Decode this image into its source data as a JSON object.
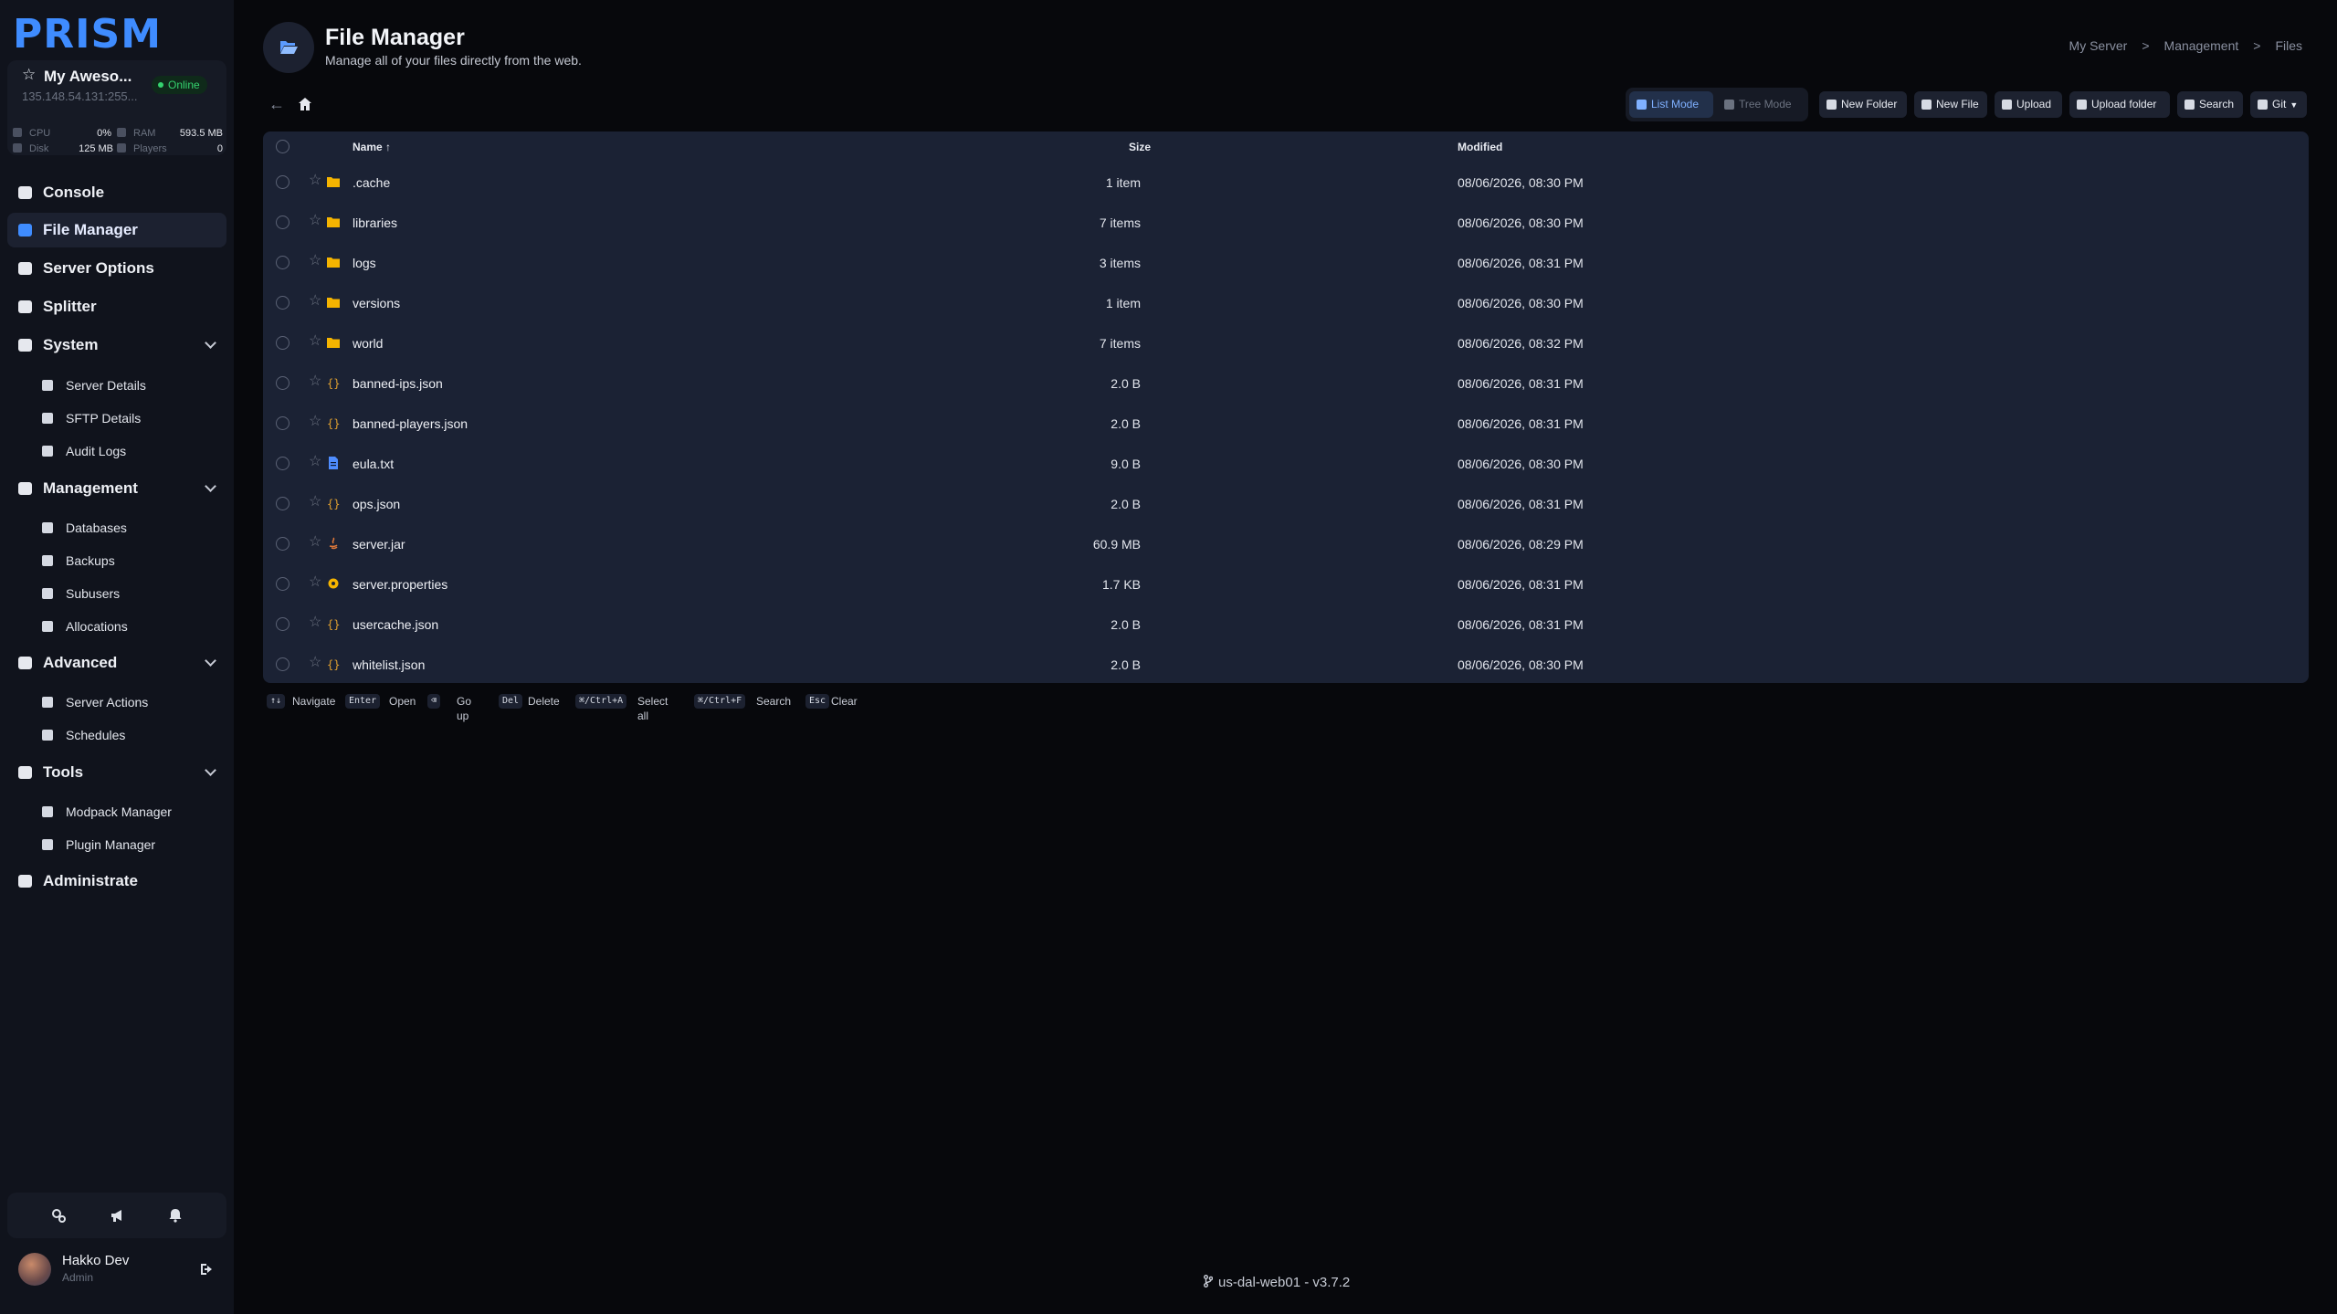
{
  "brand": {
    "logo": "PRISM"
  },
  "server": {
    "name": "My Aweso...",
    "ip": "135.148.54.131:255...",
    "status": "Online",
    "stats": {
      "cpu_label": "CPU",
      "cpu_value": "0%",
      "ram_label": "RAM",
      "ram_value": "593.5 MB",
      "disk_label": "Disk",
      "disk_value": "125 MB",
      "players_label": "Players",
      "players_value": "0"
    }
  },
  "sidebar": {
    "console": "Console",
    "file_manager": "File Manager",
    "server_options": "Server Options",
    "splitter": "Splitter",
    "system": "System",
    "system_items": [
      "Server Details",
      "SFTP Details",
      "Audit Logs"
    ],
    "management": "Management",
    "management_items": [
      "Databases",
      "Backups",
      "Subusers",
      "Allocations"
    ],
    "advanced": "Advanced",
    "advanced_items": [
      "Server Actions",
      "Schedules"
    ],
    "tools": "Tools",
    "tools_items": [
      "Modpack Manager",
      "Plugin Manager"
    ],
    "administrate": "Administrate"
  },
  "user": {
    "name": "Hakko Dev",
    "role": "Admin"
  },
  "header": {
    "title": "File Manager",
    "subtitle": "Manage all of your files directly from the web.",
    "breadcrumb": [
      "My Server",
      ">",
      "Management",
      ">",
      "Files"
    ]
  },
  "toolbar": {
    "list_mode": "List Mode",
    "tree_mode": "Tree Mode",
    "new_folder": "New Folder",
    "new_file": "New File",
    "upload": "Upload",
    "upload_folder": "Upload folder",
    "search": "Search",
    "git": "Git"
  },
  "table": {
    "headers": {
      "name": "Name ↑",
      "size": "Size",
      "modified": "Modified"
    },
    "rows": [
      {
        "name": ".cache",
        "size": "1 item",
        "modified": "08/06/2026, 08:30 PM",
        "type": "folder"
      },
      {
        "name": "libraries",
        "size": "7 items",
        "modified": "08/06/2026, 08:30 PM",
        "type": "folder"
      },
      {
        "name": "logs",
        "size": "3 items",
        "modified": "08/06/2026, 08:31 PM",
        "type": "folder"
      },
      {
        "name": "versions",
        "size": "1 item",
        "modified": "08/06/2026, 08:30 PM",
        "type": "folder"
      },
      {
        "name": "world",
        "size": "7 items",
        "modified": "08/06/2026, 08:32 PM",
        "type": "folder"
      },
      {
        "name": "banned-ips.json",
        "size": "2.0 B",
        "modified": "08/06/2026, 08:31 PM",
        "type": "json"
      },
      {
        "name": "banned-players.json",
        "size": "2.0 B",
        "modified": "08/06/2026, 08:31 PM",
        "type": "json"
      },
      {
        "name": "eula.txt",
        "size": "9.0 B",
        "modified": "08/06/2026, 08:30 PM",
        "type": "text"
      },
      {
        "name": "ops.json",
        "size": "2.0 B",
        "modified": "08/06/2026, 08:31 PM",
        "type": "json"
      },
      {
        "name": "server.jar",
        "size": "60.9 MB",
        "modified": "08/06/2026, 08:29 PM",
        "type": "java"
      },
      {
        "name": "server.properties",
        "size": "1.7 KB",
        "modified": "08/06/2026, 08:31 PM",
        "type": "config"
      },
      {
        "name": "usercache.json",
        "size": "2.0 B",
        "modified": "08/06/2026, 08:31 PM",
        "type": "json"
      },
      {
        "name": "whitelist.json",
        "size": "2.0 B",
        "modified": "08/06/2026, 08:30 PM",
        "type": "json"
      }
    ]
  },
  "shortcuts": [
    {
      "key": "↑↓",
      "label": "Navigate"
    },
    {
      "key": "Enter",
      "label": "Open"
    },
    {
      "key": "⌫",
      "label": "Go up"
    },
    {
      "key": "Del",
      "label": "Delete"
    },
    {
      "key": "⌘/Ctrl+A",
      "label": "Select all"
    },
    {
      "key": "⌘/Ctrl+F",
      "label": "Search"
    },
    {
      "key": "Esc",
      "label": "Clear"
    }
  ],
  "footer": {
    "version": "us-dal-web01 - v3.7.2"
  },
  "colors": {
    "accent": "#3f8cff",
    "online": "#35d36f",
    "folder": "#f5b400",
    "json": "#e0a030",
    "sidebar_bg": "#10131c",
    "table_bg": "#1b2234"
  }
}
